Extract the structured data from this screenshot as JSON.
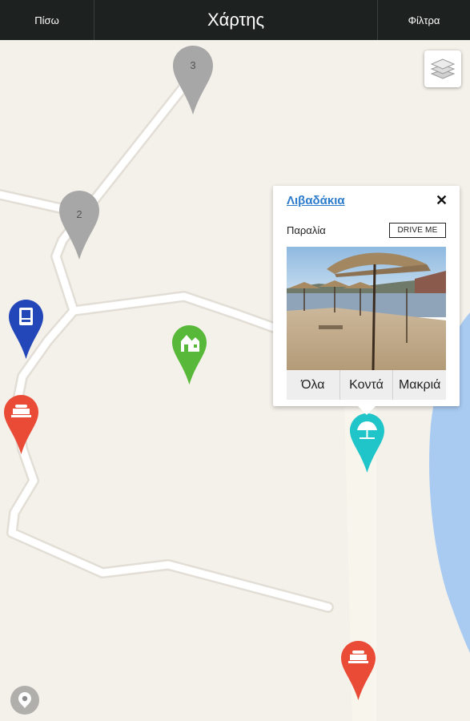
{
  "header": {
    "back_label": "Πίσω",
    "title": "Χάρτης",
    "filters_label": "Φίλτρα"
  },
  "map": {
    "clusters": [
      {
        "count": "3"
      },
      {
        "count": "2"
      }
    ],
    "markers": [
      {
        "type": "info",
        "color": "#2346b8"
      },
      {
        "type": "accommodation",
        "color": "#58b83a"
      },
      {
        "type": "food",
        "color": "#ea4b36"
      },
      {
        "type": "beach",
        "color": "#1fc5c8"
      },
      {
        "type": "food",
        "color": "#ea4b36"
      }
    ]
  },
  "popup": {
    "title": "Λιβαδάκια",
    "close_symbol": "✕",
    "category": "Παραλία",
    "drive_me_label": "DRIVE ME",
    "buttons": [
      "Όλα",
      "Κοντά",
      "Μακριά"
    ]
  },
  "icons": {
    "layers": "layers-icon",
    "locate": "location-pin-icon"
  }
}
